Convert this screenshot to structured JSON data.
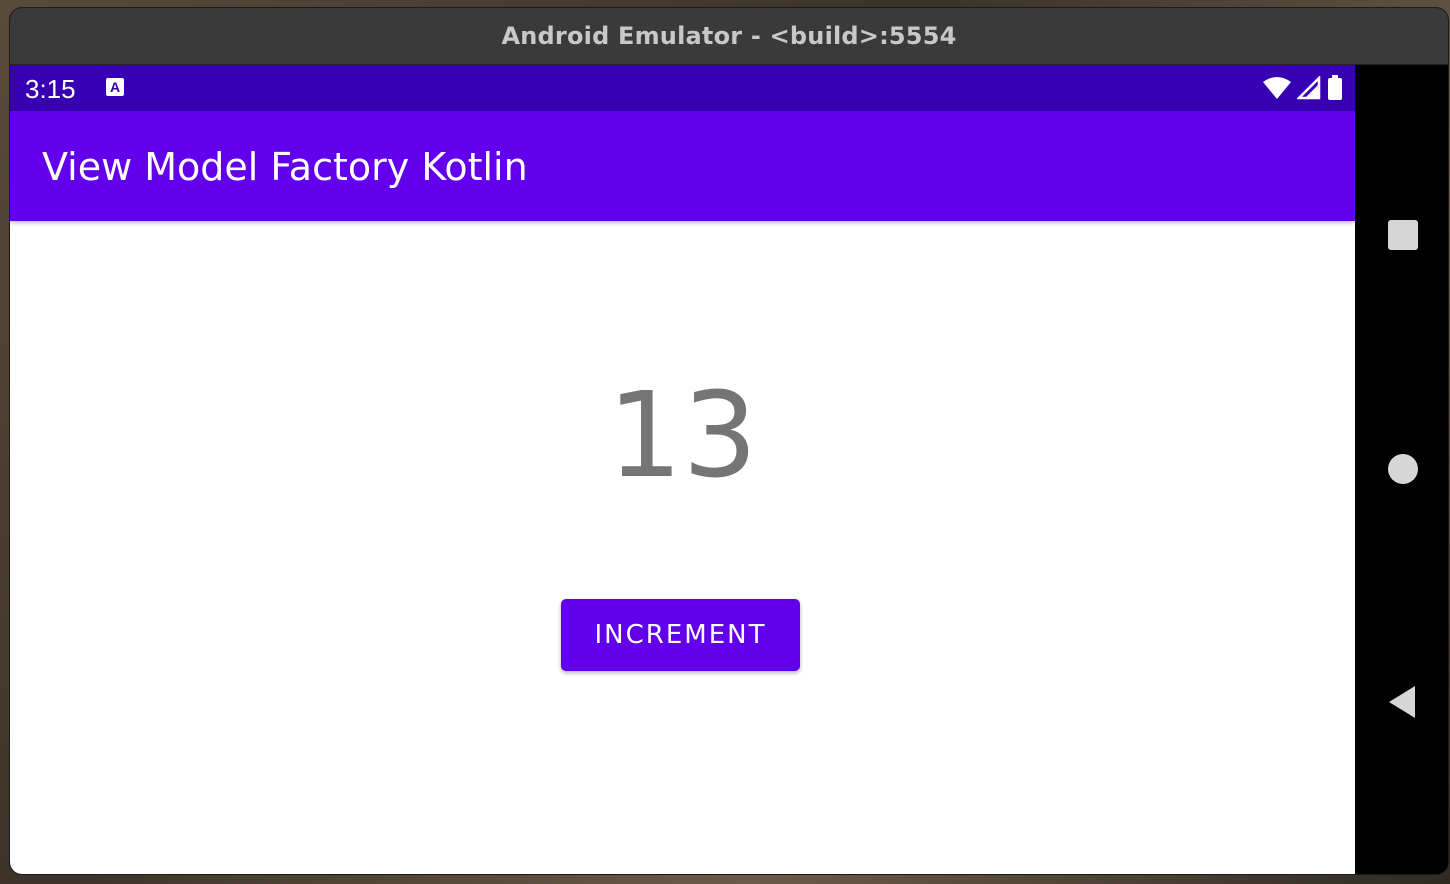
{
  "window": {
    "title": "Android Emulator - <build>:5554"
  },
  "status_bar": {
    "time": "3:15",
    "notification_icon_letter": "A",
    "icons": [
      "wifi-icon",
      "cellular-signal-icon",
      "battery-icon"
    ]
  },
  "app_bar": {
    "title": "View Model Factory Kotlin"
  },
  "main": {
    "counter_value": "13",
    "increment_label": "INCREMENT"
  },
  "nav_bar": {
    "buttons": [
      "recents-icon",
      "home-icon",
      "back-icon"
    ]
  },
  "colors": {
    "status_bar": "#3700b3",
    "primary": "#6200ee",
    "counter_text": "#757575",
    "background": "#ffffff"
  }
}
